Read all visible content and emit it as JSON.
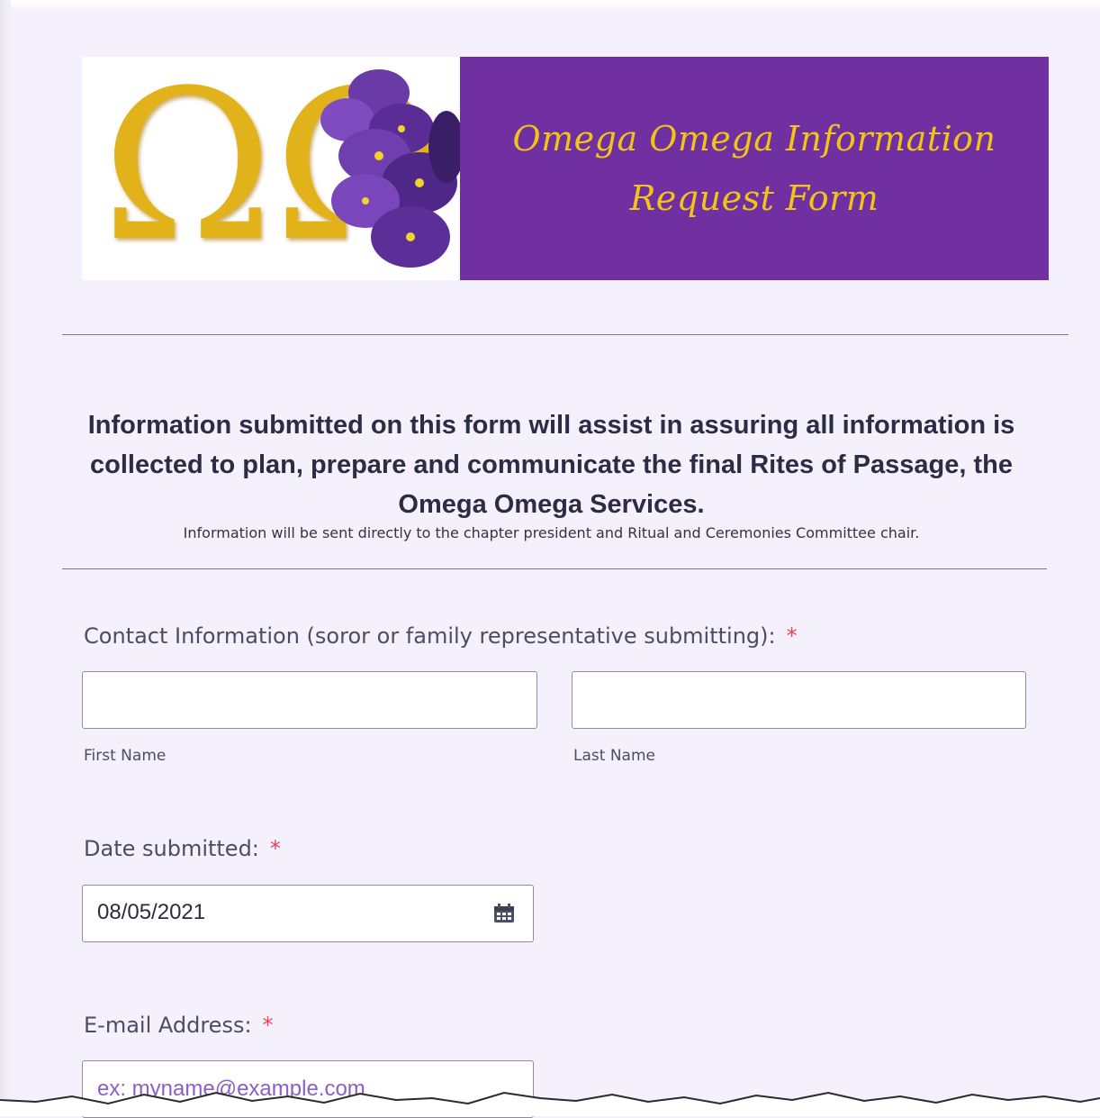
{
  "banner": {
    "logo_text": "ΩΩ",
    "title_line1": "Omega Omega Information",
    "title_line2": "Request Form",
    "colors": {
      "purple": "#7130a1",
      "gold": "#f2c417"
    }
  },
  "intro": {
    "heading": "Information submitted on this form will assist in assuring all information is collected to plan, prepare and communicate the final Rites of Passage, the Omega Omega Services.",
    "note": "Information will be sent directly to the chapter president and Ritual and Ceremonies Committee chair."
  },
  "contact": {
    "label": "Contact Information (soror or family representative submitting):",
    "required_mark": "*",
    "first_name_value": "",
    "last_name_value": "",
    "first_name_sublabel": "First Name",
    "last_name_sublabel": "Last Name"
  },
  "date": {
    "label": "Date submitted:",
    "required_mark": "*",
    "value": "08/05/2021",
    "icon": "calendar-icon"
  },
  "email": {
    "label": "E-mail Address:",
    "required_mark": "*",
    "placeholder": "ex: myname@example.com"
  }
}
